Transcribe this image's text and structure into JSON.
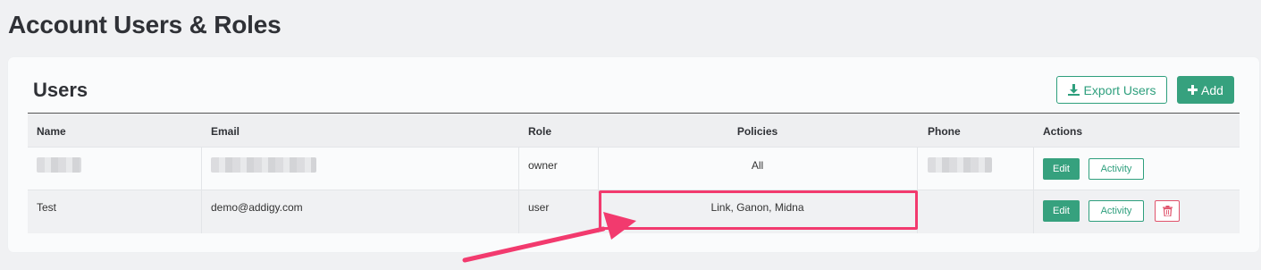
{
  "page": {
    "title": "Account Users & Roles"
  },
  "card": {
    "title": "Users",
    "export_label": "Export Users",
    "add_label": "Add"
  },
  "table": {
    "columns": [
      "Name",
      "Email",
      "Role",
      "Policies",
      "Phone",
      "Actions"
    ],
    "rows": [
      {
        "name": "",
        "email": "",
        "role": "owner",
        "policies": "All",
        "phone": "",
        "edit": "Edit",
        "activity": "Activity"
      },
      {
        "name": "Test",
        "email": "demo@addigy.com",
        "role": "user",
        "policies": "Link, Ganon, Midna",
        "phone": "",
        "edit": "Edit",
        "activity": "Activity"
      }
    ]
  },
  "colors": {
    "accent": "#36a17e",
    "danger": "#e0536c",
    "annotation": "#f23a6e"
  },
  "icons": {
    "export": "download-icon",
    "add": "plus-icon",
    "delete": "trash-icon"
  }
}
